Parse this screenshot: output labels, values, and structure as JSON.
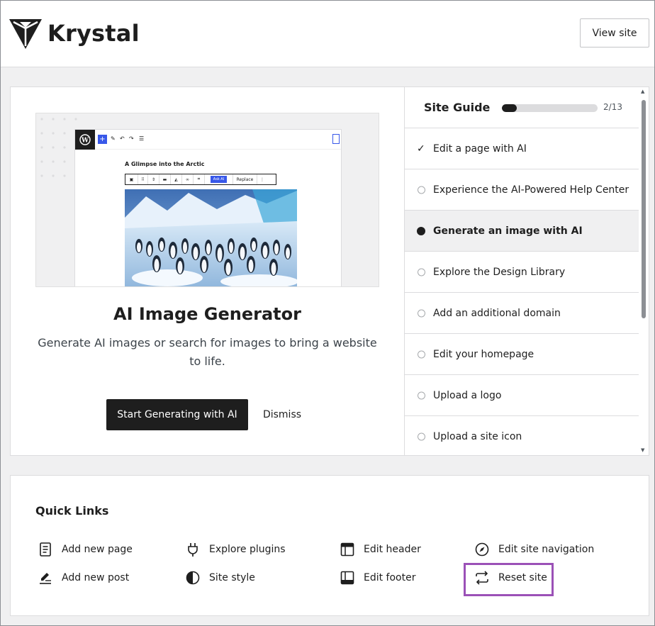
{
  "header": {
    "brand": "Krystal",
    "view_site_label": "View site"
  },
  "feature_card": {
    "preview": {
      "doc_title": "A Glimpse into the Arctic",
      "ask_ai_label": "Ask AI",
      "replace_label": "Replace"
    },
    "title": "AI Image Generator",
    "description": "Generate AI images or search for images to bring a website to life.",
    "primary_button": "Start Generating with AI",
    "dismiss_button": "Dismiss"
  },
  "site_guide": {
    "title": "Site Guide",
    "progress_text": "2/13",
    "progress_fraction": 0.154,
    "items": [
      {
        "label": "Edit a page with AI",
        "state": "done"
      },
      {
        "label": "Experience the AI-Powered Help Center",
        "state": "todo"
      },
      {
        "label": "Generate an image with AI",
        "state": "active"
      },
      {
        "label": "Explore the Design Library",
        "state": "todo"
      },
      {
        "label": "Add an additional domain",
        "state": "todo"
      },
      {
        "label": "Edit your homepage",
        "state": "todo"
      },
      {
        "label": "Upload a logo",
        "state": "todo"
      },
      {
        "label": "Upload a site icon",
        "state": "todo"
      }
    ]
  },
  "quick_links": {
    "title": "Quick Links",
    "items": [
      {
        "label": "Add new page",
        "icon": "page-icon"
      },
      {
        "label": "Explore plugins",
        "icon": "plug-icon"
      },
      {
        "label": "Edit header",
        "icon": "header-layout-icon"
      },
      {
        "label": "Edit site navigation",
        "icon": "compass-icon"
      },
      {
        "label": "Add new post",
        "icon": "post-icon"
      },
      {
        "label": "Site style",
        "icon": "contrast-icon"
      },
      {
        "label": "Edit footer",
        "icon": "footer-layout-icon"
      },
      {
        "label": "Reset site",
        "icon": "reset-arrows-icon"
      }
    ]
  },
  "colors": {
    "highlight": "#9b51b7",
    "primary_button": "#1e1e1e",
    "accent_blue": "#3858e9"
  }
}
